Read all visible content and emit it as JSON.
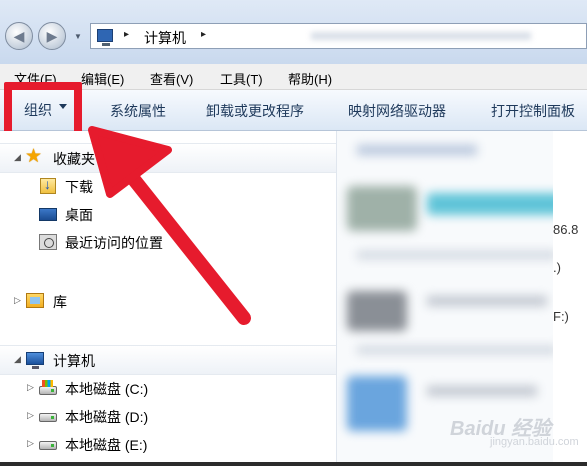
{
  "address_bar": {
    "path_segment": "计算机",
    "separator": "▸"
  },
  "menu": {
    "items": [
      "文件(F)",
      "编辑(E)",
      "查看(V)",
      "工具(T)",
      "帮助(H)"
    ]
  },
  "toolbar": {
    "organize_label": "组织",
    "system_properties_label": "系统属性",
    "uninstall_label": "卸载或更改程序",
    "map_drive_label": "映射网络驱动器",
    "control_panel_label": "打开控制面板"
  },
  "nav_pane": {
    "favorites_label": "收藏夹",
    "downloads_label": "下载",
    "desktop_label": "桌面",
    "recent_label": "最近访问的位置",
    "libraries_label": "库",
    "computer_label": "计算机",
    "drive_c_label": "本地磁盘 (C:)",
    "drive_d_label": "本地磁盘 (D:)",
    "drive_e_label": "本地磁盘 (E:)"
  },
  "content_peek": {
    "size_fragment": "86.8",
    "drive_fragment_1": ".)",
    "drive_fragment_2": "F:)"
  },
  "watermark": {
    "main": "Baidu 经验",
    "sub": "jingyan.baidu.com"
  },
  "colors": {
    "annotation_red": "#e61b2d",
    "toolbar_text": "#1e395b"
  }
}
